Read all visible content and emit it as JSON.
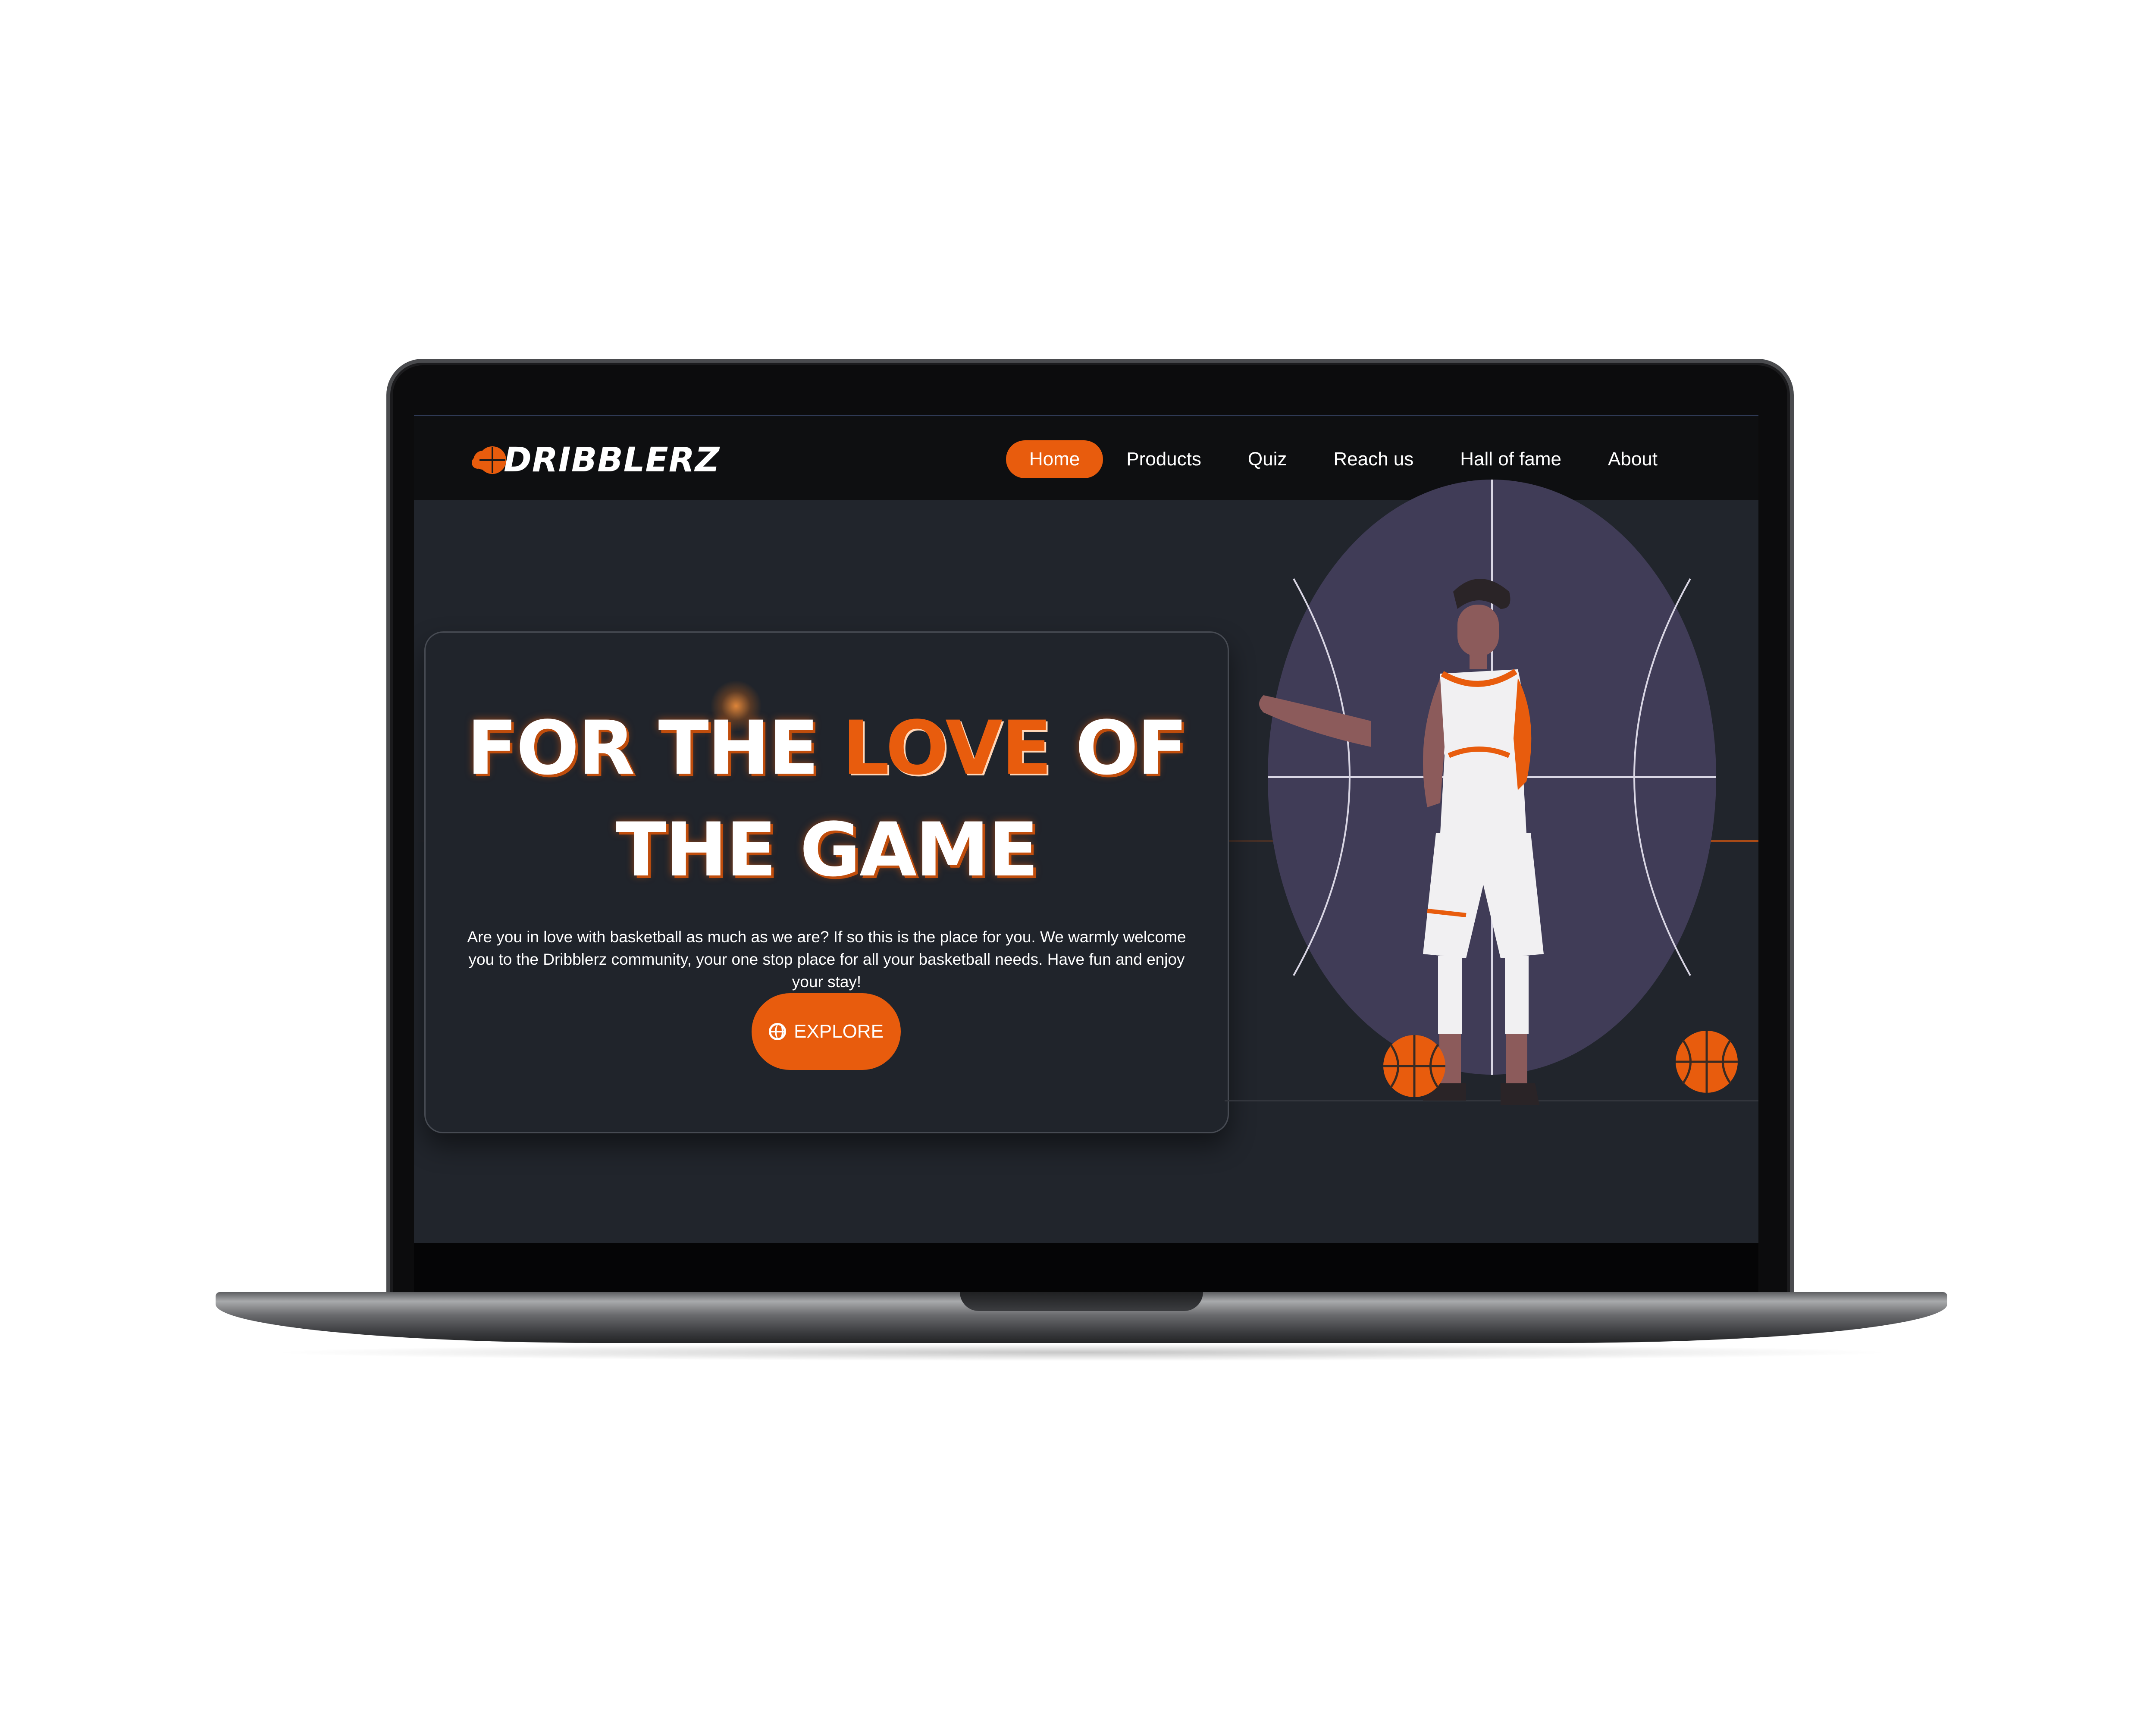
{
  "nav": {
    "logo_text": "DRIBBLERZ",
    "items": [
      {
        "label": "Home",
        "active": true
      },
      {
        "label": "Products"
      },
      {
        "label": "Quiz"
      },
      {
        "label": "Reach us"
      },
      {
        "label": "Hall of fame"
      },
      {
        "label": "About"
      }
    ]
  },
  "hero": {
    "headline_part1": "FOR THE ",
    "headline_highlight": "LOVE",
    "headline_part2": " OF THE GAME",
    "description": "Are you in love with basketball as much as we are? If so this is the place for you. We warmly welcome you to the Dribblerz community, your one stop place for all your basketball needs. Have fun and enjoy your stay!",
    "cta_label": "EXPLORE",
    "cta_icon": "globe-icon"
  },
  "colors": {
    "accent": "#e85c0d",
    "page_bg": "#21252c",
    "nav_bg": "#0e0f11",
    "court_purple": "#403c57"
  }
}
